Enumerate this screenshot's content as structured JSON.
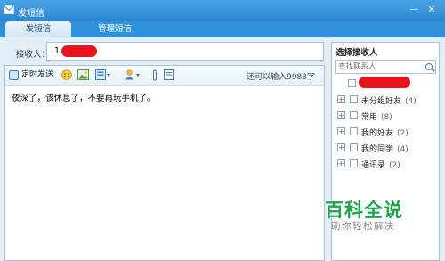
{
  "window": {
    "title": "发短信",
    "accent": "#2f8fd8"
  },
  "tabs": [
    {
      "label": "发短信",
      "active": true
    },
    {
      "label": "管理短信",
      "active": false
    }
  ],
  "recipient": {
    "label": "接收人：",
    "value": "1"
  },
  "toolbar": {
    "schedule_label": "定时发送",
    "remaining_text": "还可以输入9983字",
    "icons": [
      "clock-icon",
      "smiley-icon",
      "image-icon",
      "template-icon",
      "contact-icon",
      "attachment-icon",
      "note-icon"
    ]
  },
  "message": {
    "text": "夜深了，该休息了，不要再玩手机了。"
  },
  "sidebar": {
    "heading": "选择接收人",
    "search_placeholder": "查找联系人",
    "groups": [
      {
        "name": "未分组好友",
        "count": "(4)"
      },
      {
        "name": "常用",
        "count": "(8)"
      },
      {
        "name": "我的好友",
        "count": "(2)"
      },
      {
        "name": "我的同学",
        "count": "(4)"
      },
      {
        "name": "通讯录",
        "count": "(2)"
      }
    ]
  },
  "watermark": {
    "title": "百科全说",
    "subtitle": "助你轻松解决",
    "color": "#1fa34a"
  }
}
